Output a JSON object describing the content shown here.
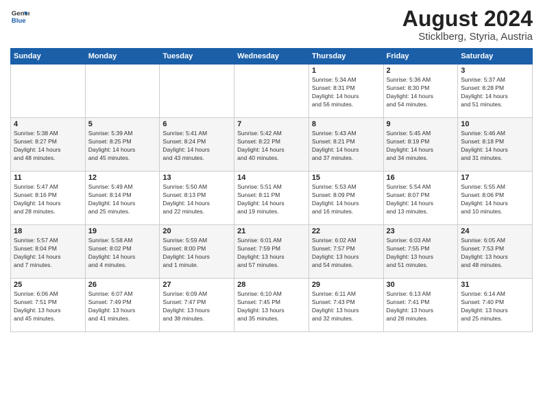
{
  "logo": {
    "line1": "General",
    "line2": "Blue"
  },
  "title": "August 2024",
  "location": "Sticklberg, Styria, Austria",
  "weekdays": [
    "Sunday",
    "Monday",
    "Tuesday",
    "Wednesday",
    "Thursday",
    "Friday",
    "Saturday"
  ],
  "weeks": [
    [
      {
        "day": "",
        "info": ""
      },
      {
        "day": "",
        "info": ""
      },
      {
        "day": "",
        "info": ""
      },
      {
        "day": "",
        "info": ""
      },
      {
        "day": "1",
        "info": "Sunrise: 5:34 AM\nSunset: 8:31 PM\nDaylight: 14 hours\nand 56 minutes."
      },
      {
        "day": "2",
        "info": "Sunrise: 5:36 AM\nSunset: 8:30 PM\nDaylight: 14 hours\nand 54 minutes."
      },
      {
        "day": "3",
        "info": "Sunrise: 5:37 AM\nSunset: 8:28 PM\nDaylight: 14 hours\nand 51 minutes."
      }
    ],
    [
      {
        "day": "4",
        "info": "Sunrise: 5:38 AM\nSunset: 8:27 PM\nDaylight: 14 hours\nand 48 minutes."
      },
      {
        "day": "5",
        "info": "Sunrise: 5:39 AM\nSunset: 8:25 PM\nDaylight: 14 hours\nand 45 minutes."
      },
      {
        "day": "6",
        "info": "Sunrise: 5:41 AM\nSunset: 8:24 PM\nDaylight: 14 hours\nand 43 minutes."
      },
      {
        "day": "7",
        "info": "Sunrise: 5:42 AM\nSunset: 8:22 PM\nDaylight: 14 hours\nand 40 minutes."
      },
      {
        "day": "8",
        "info": "Sunrise: 5:43 AM\nSunset: 8:21 PM\nDaylight: 14 hours\nand 37 minutes."
      },
      {
        "day": "9",
        "info": "Sunrise: 5:45 AM\nSunset: 8:19 PM\nDaylight: 14 hours\nand 34 minutes."
      },
      {
        "day": "10",
        "info": "Sunrise: 5:46 AM\nSunset: 8:18 PM\nDaylight: 14 hours\nand 31 minutes."
      }
    ],
    [
      {
        "day": "11",
        "info": "Sunrise: 5:47 AM\nSunset: 8:16 PM\nDaylight: 14 hours\nand 28 minutes."
      },
      {
        "day": "12",
        "info": "Sunrise: 5:49 AM\nSunset: 8:14 PM\nDaylight: 14 hours\nand 25 minutes."
      },
      {
        "day": "13",
        "info": "Sunrise: 5:50 AM\nSunset: 8:13 PM\nDaylight: 14 hours\nand 22 minutes."
      },
      {
        "day": "14",
        "info": "Sunrise: 5:51 AM\nSunset: 8:11 PM\nDaylight: 14 hours\nand 19 minutes."
      },
      {
        "day": "15",
        "info": "Sunrise: 5:53 AM\nSunset: 8:09 PM\nDaylight: 14 hours\nand 16 minutes."
      },
      {
        "day": "16",
        "info": "Sunrise: 5:54 AM\nSunset: 8:07 PM\nDaylight: 14 hours\nand 13 minutes."
      },
      {
        "day": "17",
        "info": "Sunrise: 5:55 AM\nSunset: 8:06 PM\nDaylight: 14 hours\nand 10 minutes."
      }
    ],
    [
      {
        "day": "18",
        "info": "Sunrise: 5:57 AM\nSunset: 8:04 PM\nDaylight: 14 hours\nand 7 minutes."
      },
      {
        "day": "19",
        "info": "Sunrise: 5:58 AM\nSunset: 8:02 PM\nDaylight: 14 hours\nand 4 minutes."
      },
      {
        "day": "20",
        "info": "Sunrise: 5:59 AM\nSunset: 8:00 PM\nDaylight: 14 hours\nand 1 minute."
      },
      {
        "day": "21",
        "info": "Sunrise: 6:01 AM\nSunset: 7:59 PM\nDaylight: 13 hours\nand 57 minutes."
      },
      {
        "day": "22",
        "info": "Sunrise: 6:02 AM\nSunset: 7:57 PM\nDaylight: 13 hours\nand 54 minutes."
      },
      {
        "day": "23",
        "info": "Sunrise: 6:03 AM\nSunset: 7:55 PM\nDaylight: 13 hours\nand 51 minutes."
      },
      {
        "day": "24",
        "info": "Sunrise: 6:05 AM\nSunset: 7:53 PM\nDaylight: 13 hours\nand 48 minutes."
      }
    ],
    [
      {
        "day": "25",
        "info": "Sunrise: 6:06 AM\nSunset: 7:51 PM\nDaylight: 13 hours\nand 45 minutes."
      },
      {
        "day": "26",
        "info": "Sunrise: 6:07 AM\nSunset: 7:49 PM\nDaylight: 13 hours\nand 41 minutes."
      },
      {
        "day": "27",
        "info": "Sunrise: 6:09 AM\nSunset: 7:47 PM\nDaylight: 13 hours\nand 38 minutes."
      },
      {
        "day": "28",
        "info": "Sunrise: 6:10 AM\nSunset: 7:45 PM\nDaylight: 13 hours\nand 35 minutes."
      },
      {
        "day": "29",
        "info": "Sunrise: 6:11 AM\nSunset: 7:43 PM\nDaylight: 13 hours\nand 32 minutes."
      },
      {
        "day": "30",
        "info": "Sunrise: 6:13 AM\nSunset: 7:41 PM\nDaylight: 13 hours\nand 28 minutes."
      },
      {
        "day": "31",
        "info": "Sunrise: 6:14 AM\nSunset: 7:40 PM\nDaylight: 13 hours\nand 25 minutes."
      }
    ]
  ]
}
